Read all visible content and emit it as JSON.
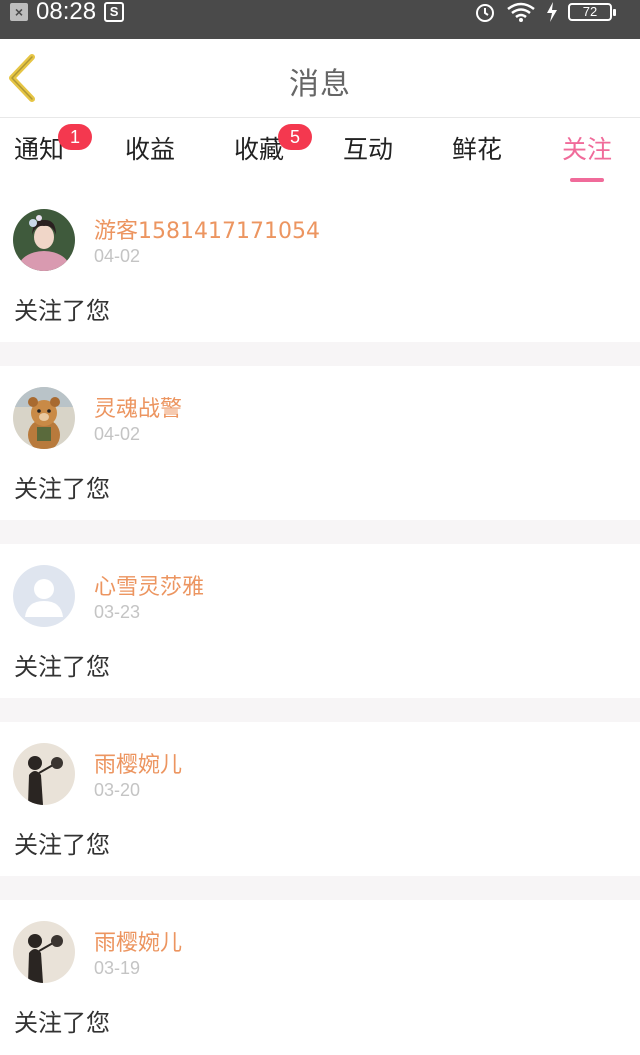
{
  "status": {
    "time": "08:28",
    "battery": "72"
  },
  "nav": {
    "title": "消息",
    "back_icon": "chevron-left-icon"
  },
  "tabs": [
    {
      "label": "通知",
      "badge": "1"
    },
    {
      "label": "收益",
      "badge": ""
    },
    {
      "label": "收藏",
      "badge": "5"
    },
    {
      "label": "互动",
      "badge": ""
    },
    {
      "label": "鲜花",
      "badge": ""
    },
    {
      "label": "关注",
      "badge": "",
      "active": true
    }
  ],
  "messages": [
    {
      "name": "游客1581417171054",
      "date": "04-02",
      "text": "关注了您",
      "avatar": "woman-portrait-avatar"
    },
    {
      "name": "灵魂战警",
      "date": "04-02",
      "text": "关注了您",
      "avatar": "teddy-bear-avatar"
    },
    {
      "name": "心雪灵莎雅",
      "date": "03-23",
      "text": "关注了您",
      "avatar": "default-person-avatar"
    },
    {
      "name": "雨樱婉儿",
      "date": "03-20",
      "text": "关注了您",
      "avatar": "silhouette-avatar"
    },
    {
      "name": "雨樱婉儿",
      "date": "03-19",
      "text": "关注了您",
      "avatar": "silhouette-avatar"
    }
  ],
  "colors": {
    "accent": "#f06b9a",
    "name": "#ec9560",
    "badge": "#f4384f",
    "back_arrow": "#e6c544"
  }
}
